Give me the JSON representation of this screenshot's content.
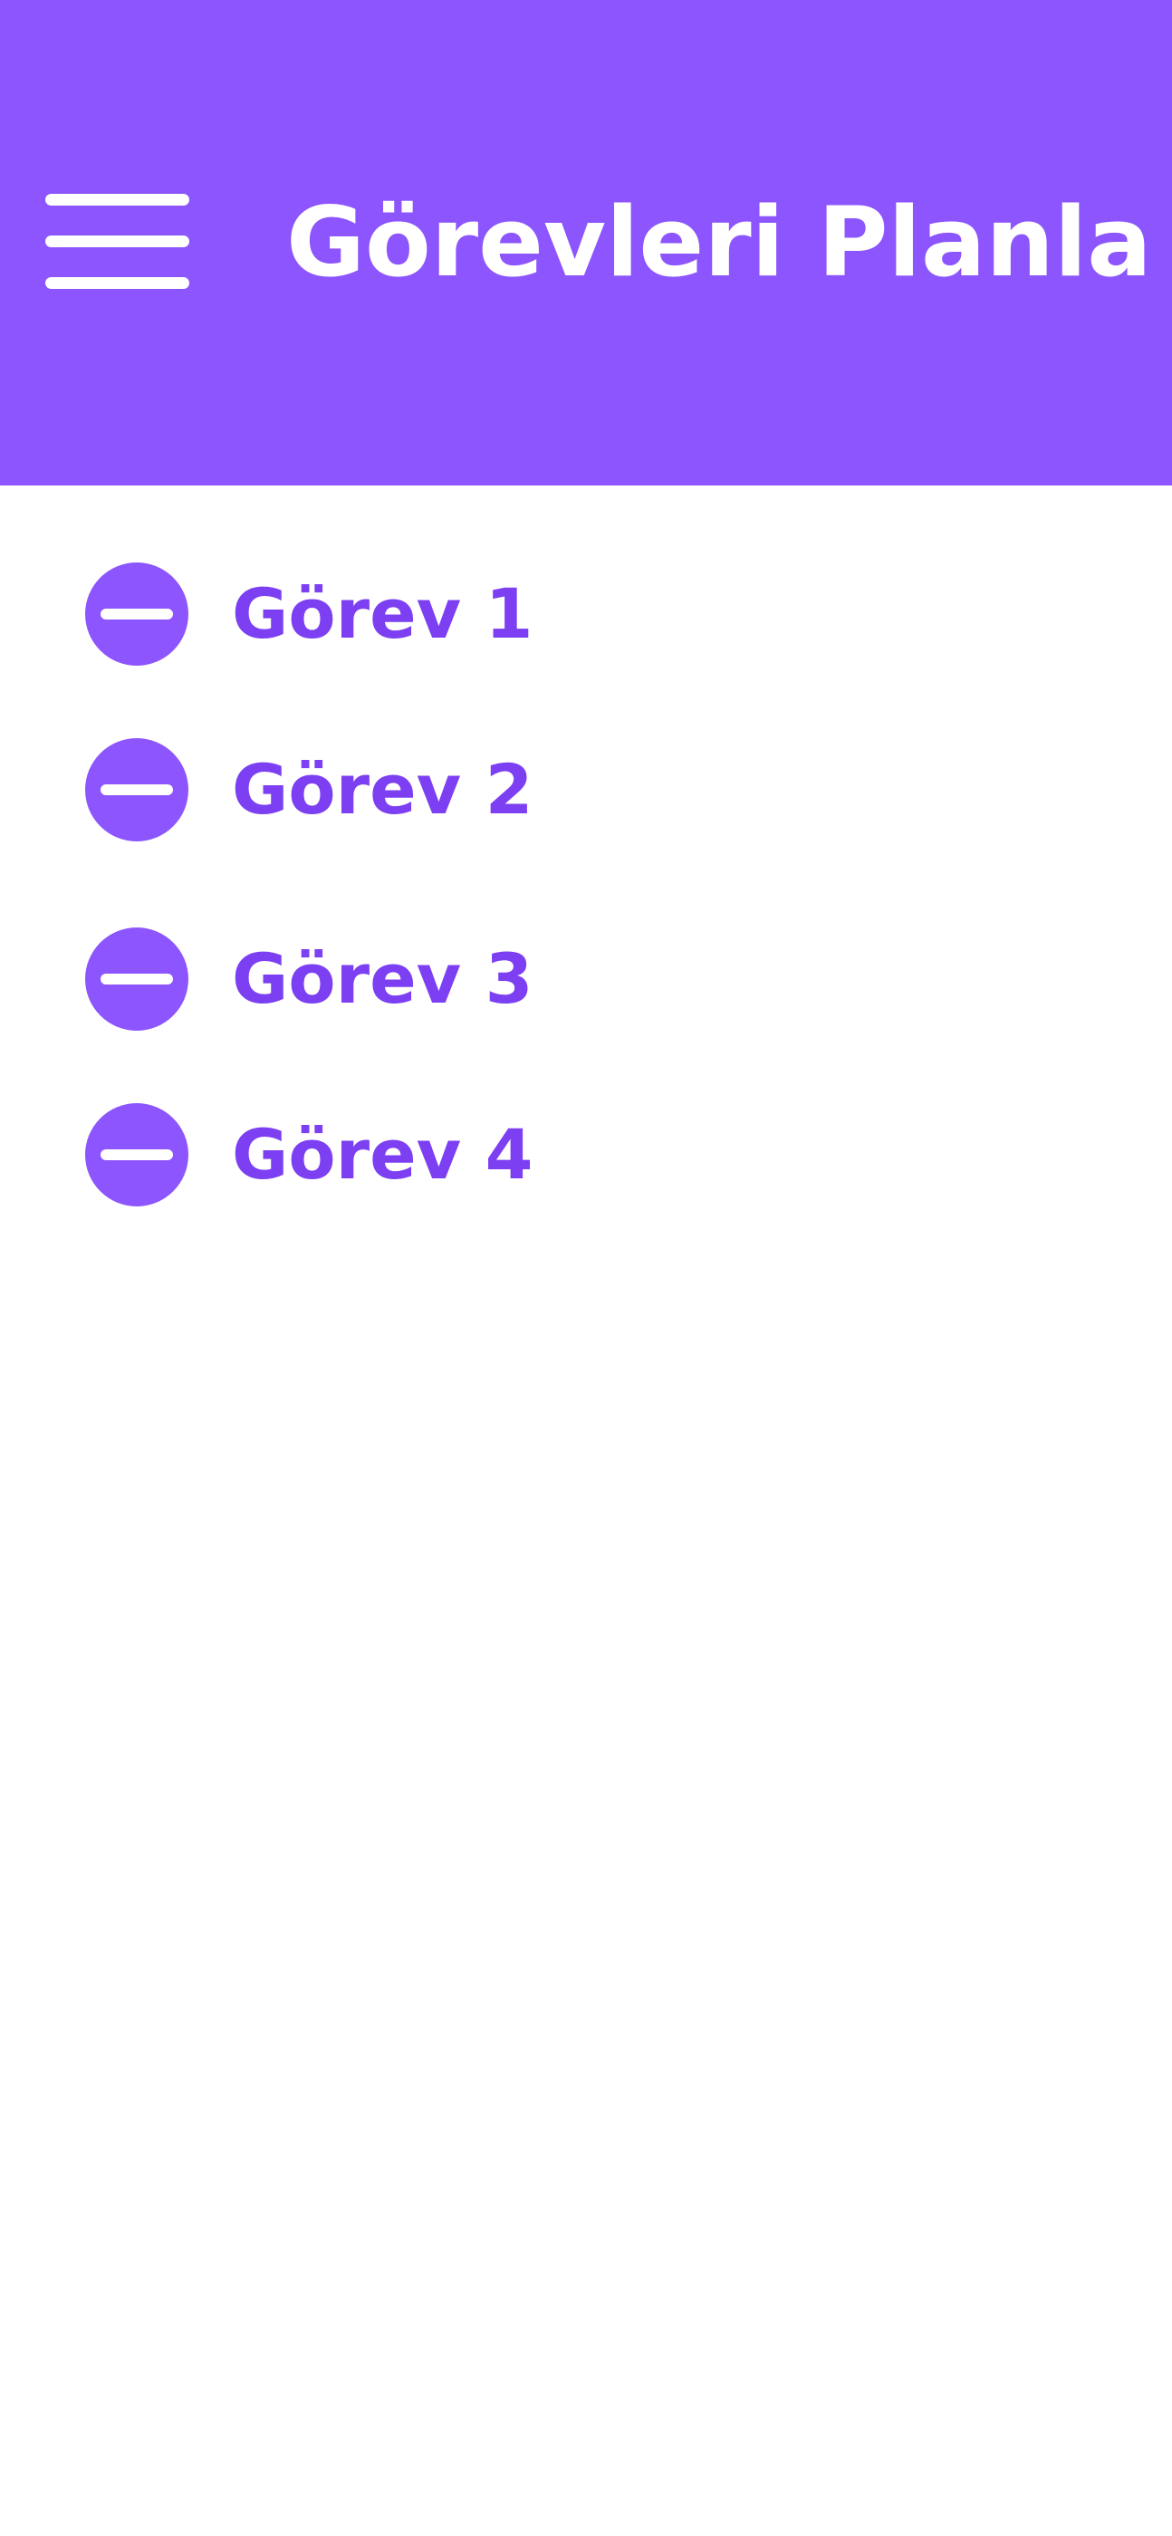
{
  "header": {
    "title": "Görevleri Planla",
    "menu_icon": "hamburger-menu-icon",
    "background_color": "#8c55fd"
  },
  "tasks": [
    {
      "label": "Görev 1",
      "action_icon": "minus-circle-icon"
    },
    {
      "label": "Görev 2",
      "action_icon": "minus-circle-icon"
    },
    {
      "label": "Görev 3",
      "action_icon": "minus-circle-icon"
    },
    {
      "label": "Görev 4",
      "action_icon": "minus-circle-icon"
    }
  ],
  "colors": {
    "accent": "#8c55fd",
    "task_text": "#7c3ff2",
    "background": "#ffffff"
  }
}
